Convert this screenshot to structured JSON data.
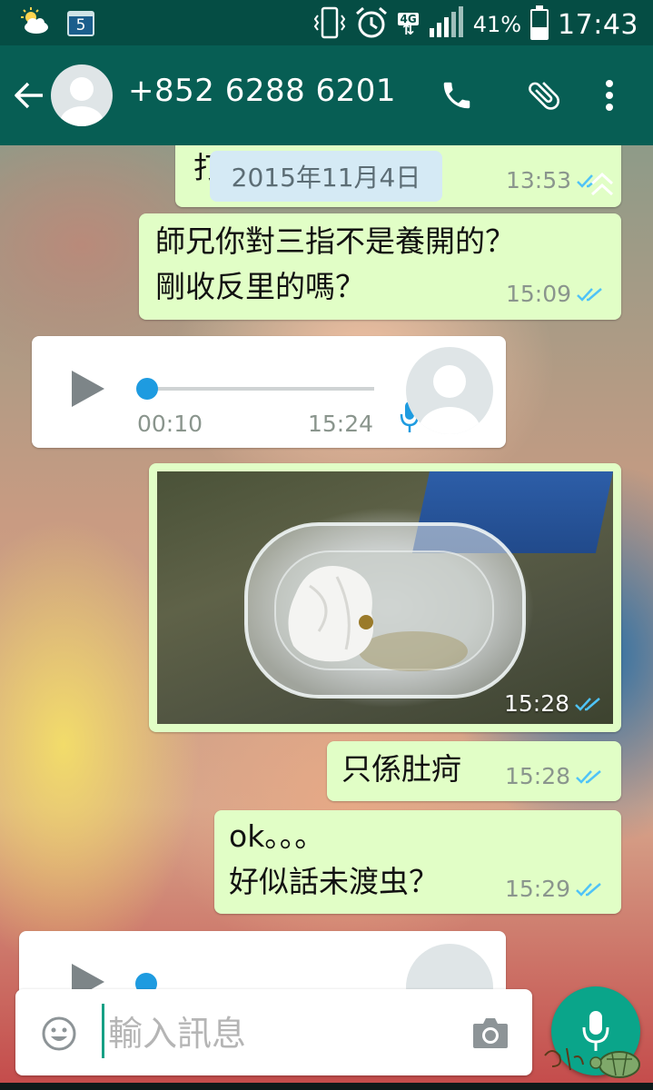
{
  "status_bar": {
    "calendar_day": "5",
    "network_type": "4G",
    "battery_percent": "41%",
    "battery_level": 0.41,
    "time": "17:43",
    "icons": [
      "weather-partly-cloudy-icon",
      "calendar-icon",
      "vibrate-icon",
      "alarm-icon",
      "signal-icon",
      "battery-icon"
    ]
  },
  "app_bar": {
    "contact_name": "+852 6288 6201",
    "icons": [
      "back-arrow-icon",
      "avatar-icon",
      "phone-icon",
      "paperclip-icon",
      "more-vert-icon"
    ]
  },
  "chat": {
    "date_chip": "2015年11月4日",
    "messages": [
      {
        "type": "text",
        "direction": "outgoing",
        "partial": true,
        "visible_text": "打",
        "time": "13:53",
        "status": "read"
      },
      {
        "type": "text",
        "direction": "outgoing",
        "lines": [
          "師兄你對三指不是養開的？",
          "剛收反里的嗎？"
        ],
        "time": "15:09",
        "status": "read"
      },
      {
        "type": "voice",
        "direction": "incoming",
        "duration": "00:10",
        "time": "15:24",
        "progress": 0.0
      },
      {
        "type": "image",
        "direction": "outgoing",
        "time": "15:28",
        "status": "read"
      },
      {
        "type": "text",
        "direction": "outgoing",
        "lines": [
          "只係肚疴"
        ],
        "time": "15:28",
        "status": "read"
      },
      {
        "type": "text",
        "direction": "outgoing",
        "lines": [
          "ok。。。",
          "好似話未渡虫？"
        ],
        "time": "15:29",
        "status": "read"
      },
      {
        "type": "voice",
        "direction": "incoming",
        "partial": true
      }
    ]
  },
  "input": {
    "placeholder": "輸入訊息",
    "icons": [
      "emoji-icon",
      "camera-icon",
      "mic-icon"
    ]
  },
  "colors": {
    "status_bar": "#054d44",
    "app_bar": "#075e54",
    "outgoing_bubble": "#e1fec6",
    "incoming_bubble": "#ffffff",
    "read_tick": "#4fc3f7",
    "accent": "#0aa58a",
    "seek": "#1e9be0"
  }
}
